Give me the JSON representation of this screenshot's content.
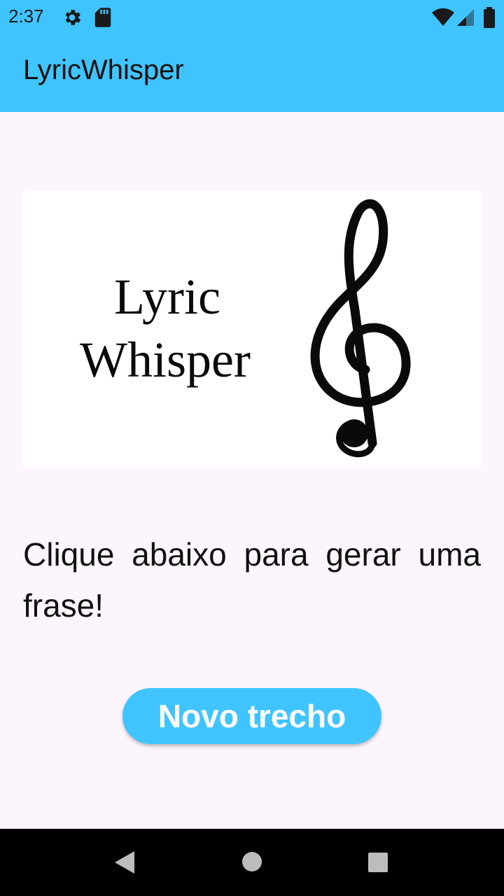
{
  "status_bar": {
    "time": "2:37",
    "icons": [
      "gear-icon",
      "sd-card-icon",
      "wifi-icon",
      "signal-icon",
      "battery-icon"
    ]
  },
  "app_bar": {
    "title": "LyricWhisper"
  },
  "logo": {
    "line1": "Lyric",
    "line2": "Whisper",
    "icon": "treble-clef-icon"
  },
  "main": {
    "prompt": "Clique abaixo para gerar uma frase!",
    "button_label": "Novo trecho"
  },
  "nav_bar": {
    "icons": [
      "back-icon",
      "home-icon",
      "recents-icon"
    ]
  },
  "colors": {
    "accent": "#40C4FF",
    "background": "#FCF5FD"
  }
}
